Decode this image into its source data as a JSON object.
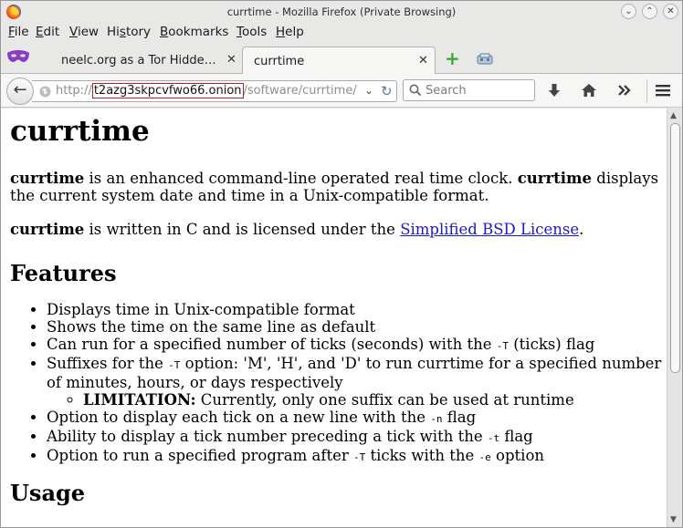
{
  "window": {
    "title": "currtime - Mozilla Firefox (Private Browsing)"
  },
  "menu": [
    "File",
    "Edit",
    "View",
    "History",
    "Bookmarks",
    "Tools",
    "Help"
  ],
  "menu_access_keys": [
    "F",
    "E",
    "V",
    "s",
    "B",
    "T",
    "H"
  ],
  "tabs": [
    {
      "label": "neelc.org as a Tor Hidde…",
      "close": "✕"
    },
    {
      "label": "currtime",
      "close": "✕"
    }
  ],
  "url": {
    "scheme": "http://",
    "host": "t2azg3skpcvfwo66.onion",
    "path": "/software/currtime/"
  },
  "search": {
    "placeholder": "Search"
  },
  "icons": {
    "back": "arrow-left",
    "downloads": "download-arrow",
    "home": "home",
    "overflow": "chevron-double-right",
    "menu": "hamburger"
  },
  "page": {
    "title": "currtime",
    "intro": {
      "name": "currtime",
      "text1": " is an enhanced command-line operated real time clock. ",
      "name2": "currtime",
      "text2": " displays the current system date and time in a Unix-compatible format."
    },
    "license": {
      "name": "currtime",
      "text1": " is written in C and is licensed under the ",
      "link": "Simplified BSD License",
      "text2": "."
    },
    "features_heading": "Features",
    "features": [
      "Displays time in Unix-compatible format",
      "Shows the time on the same line as default",
      "Can run for a specified number of ticks (seconds) with the ",
      "Suffixes for the ",
      "Option to display each tick on a new line with the ",
      "Ability to display a tick number preceding a tick with the ",
      "Option to run a specified program after "
    ],
    "feature_parts": {
      "ticks_flag": "-T",
      "ticks_rest": " (ticks) flag",
      "suffix_flag": "-T",
      "suffix_rest": " option: 'M', 'H', and 'D' to run currtime for a specified number of minutes, hours, or days respectively",
      "limitation_label": "LIMITATION:",
      "limitation_text": " Currently, only one suffix can be used at runtime",
      "newline_flag": "-n",
      "newline_rest": " flag",
      "number_flag": "-t",
      "number_rest": " flag",
      "exec_flag": "-T",
      "exec_mid": " ticks with the ",
      "exec_flag2": "-e",
      "exec_rest": " option"
    },
    "usage_heading": "Usage"
  },
  "colors": {
    "chrome": "#e8e8e7",
    "link": "#1a1acd",
    "host_outline": "#b82222",
    "private_mask": "#8a3cc6"
  }
}
